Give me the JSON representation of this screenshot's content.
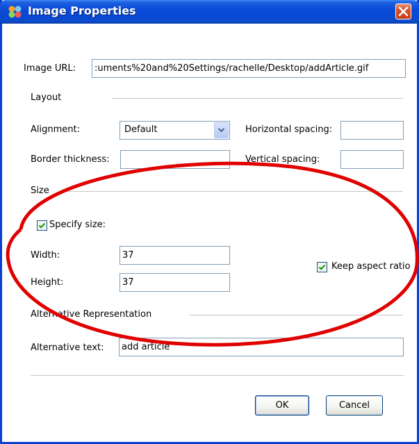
{
  "window": {
    "title": "Image Properties",
    "close_icon": "close-icon",
    "app_icon": "app-icon",
    "accent": "#0a4bd8"
  },
  "image_url": {
    "label": "Image URL:",
    "value": ":uments%20and%20Settings/rachelle/Desktop/addArticle.gif"
  },
  "layout": {
    "section_label": "Layout",
    "alignment_label": "Alignment:",
    "alignment_value": "Default",
    "horizontal_spacing_label": "Horizontal spacing:",
    "horizontal_spacing_value": "",
    "border_thickness_label": "Border thickness:",
    "border_thickness_value": "",
    "vertical_spacing_label": "Vertical spacing:",
    "vertical_spacing_value": ""
  },
  "size": {
    "section_label": "Size",
    "specify_size_label": "Specify size:",
    "specify_size_checked": true,
    "width_label": "Width:",
    "width_value": "37",
    "height_label": "Height:",
    "height_value": "37",
    "keep_aspect_label": "Keep aspect ratio",
    "keep_aspect_checked": true
  },
  "alternative": {
    "section_label": "Alternative Representation",
    "text_label": "Alternative text:",
    "text_value": "add article"
  },
  "buttons": {
    "ok": "OK",
    "cancel": "Cancel"
  },
  "annotation": {
    "color": "#e00000"
  }
}
